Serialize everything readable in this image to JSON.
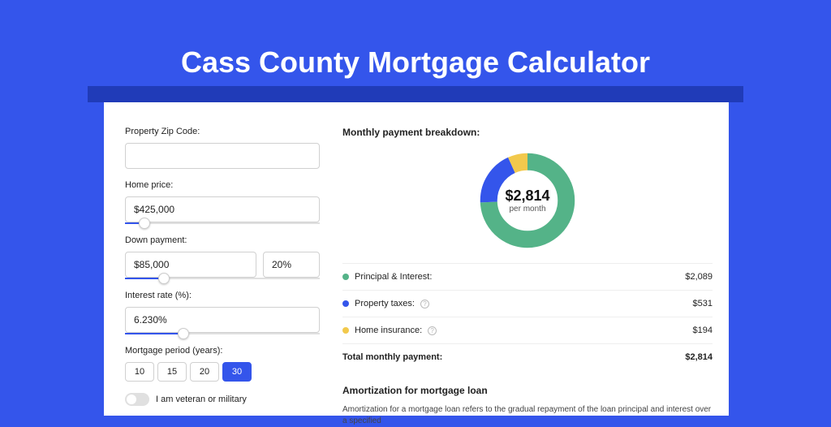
{
  "title": "Cass County Mortgage Calculator",
  "form": {
    "zip_label": "Property Zip Code:",
    "zip_value": "",
    "home_price_label": "Home price:",
    "home_price_value": "$425,000",
    "down_payment_label": "Down payment:",
    "down_payment_value": "$85,000",
    "down_payment_pct": "20%",
    "interest_label": "Interest rate (%):",
    "interest_value": "6.230%",
    "period_label": "Mortgage period (years):",
    "periods": [
      "10",
      "15",
      "20",
      "30"
    ],
    "period_selected": "30",
    "veteran_label": "I am veteran or military"
  },
  "breakdown": {
    "heading": "Monthly payment breakdown:",
    "center_amount": "$2,814",
    "center_sub": "per month",
    "rows": [
      {
        "label": "Principal & Interest:",
        "amount": "$2,089",
        "color": "#54b388",
        "info": false
      },
      {
        "label": "Property taxes:",
        "amount": "$531",
        "color": "#3455eb",
        "info": true
      },
      {
        "label": "Home insurance:",
        "amount": "$194",
        "color": "#f2c94c",
        "info": true
      }
    ],
    "total_label": "Total monthly payment:",
    "total_amount": "$2,814"
  },
  "amortization": {
    "heading": "Amortization for mortgage loan",
    "body": "Amortization for a mortgage loan refers to the gradual repayment of the loan principal and interest over a specified"
  },
  "chart_data": {
    "type": "pie",
    "title": "Monthly payment breakdown",
    "series": [
      {
        "name": "Principal & Interest",
        "value": 2089,
        "color": "#54b388"
      },
      {
        "name": "Property taxes",
        "value": 531,
        "color": "#3455eb"
      },
      {
        "name": "Home insurance",
        "value": 194,
        "color": "#f2c94c"
      }
    ],
    "total": 2814,
    "center_label": "$2,814",
    "center_sub": "per month"
  }
}
